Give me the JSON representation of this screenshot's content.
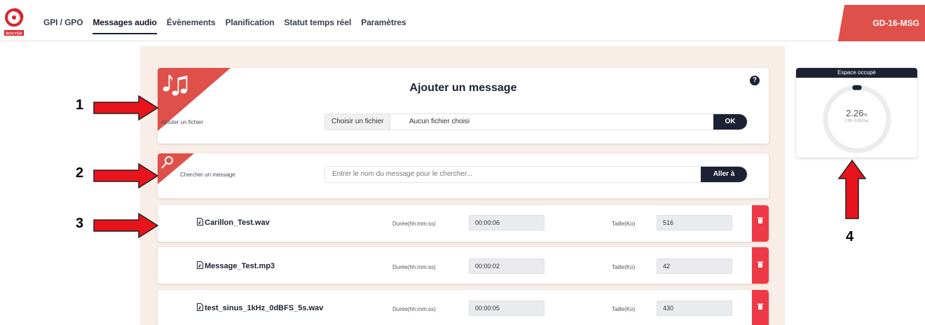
{
  "nav": {
    "items": [
      "GPI / GPO",
      "Messages audio",
      "Évènements",
      "Planification",
      "Statut temps réel",
      "Paramètres"
    ],
    "active_index": 1
  },
  "brand": {
    "logo_text": "BOUYER",
    "accent": "#e0504a"
  },
  "device": {
    "name": "GD-16-MSG"
  },
  "add_message": {
    "title": "Ajouter un message",
    "label": "Ajouter un fichier",
    "choose_button": "Choisir un fichier",
    "no_file": "Aucun fichier choisi",
    "ok_button": "OK",
    "help": "?"
  },
  "search": {
    "label": "Chercher un message",
    "placeholder": "Entrer le nom du message pour le chercher...",
    "go_button": "Aller à"
  },
  "messages": {
    "duration_label": "Durée(hh:mm:ss)",
    "size_label": "Taille(Ko)",
    "rows": [
      {
        "name": "Carillon_Test.wav",
        "duration": "00:00:06",
        "size": "516"
      },
      {
        "name": "Message_Test.mp3",
        "duration": "00:00:02",
        "size": "42"
      },
      {
        "name": "test_sinus_1kHz_0dBFS_5s.wav",
        "duration": "00:00:05",
        "size": "430"
      }
    ]
  },
  "space": {
    "title": "Espace occupé",
    "percent": "2.26",
    "percent_unit": "%",
    "detail": "0.09 / 3.81(Go)",
    "fill_fraction": 0.0226
  },
  "annotations": [
    "1",
    "2",
    "3",
    "4"
  ],
  "colors": {
    "dark": "#1c2234",
    "red": "#e0504a",
    "trash": "#ee3a46",
    "panel": "#f8ede7"
  }
}
